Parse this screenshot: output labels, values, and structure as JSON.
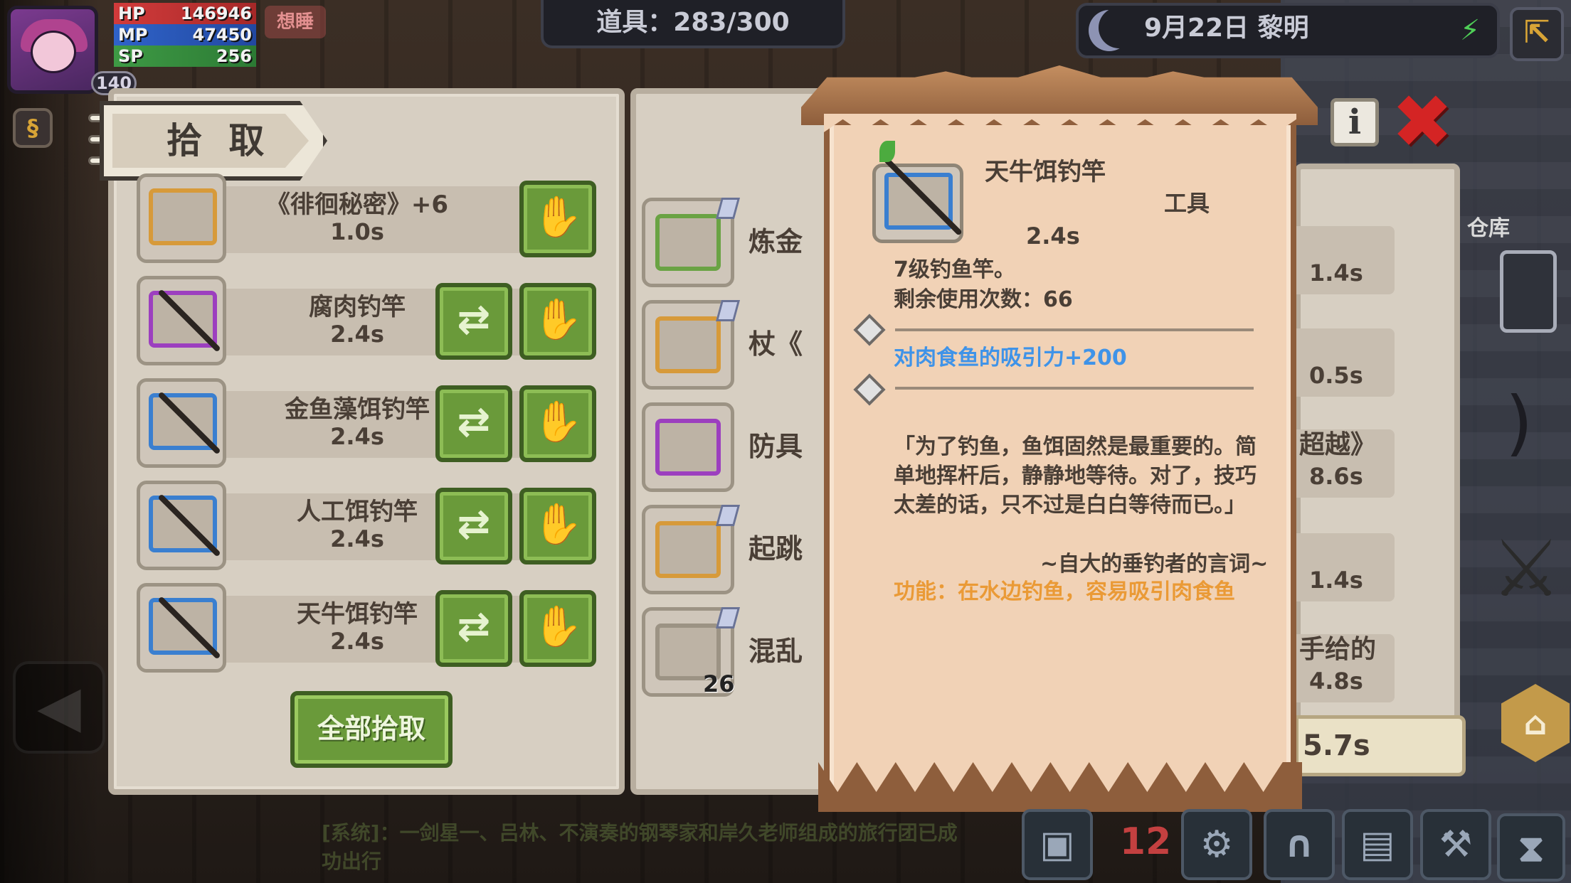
{
  "hud": {
    "hp_label": "HP",
    "hp_value": "146946",
    "mp_label": "MP",
    "mp_value": "47450",
    "sp_label": "SP",
    "sp_value": "256",
    "level": "140",
    "status": "想睡",
    "inventory_counter": "道具：283/300",
    "date": "9月22日  黎明"
  },
  "pickup": {
    "title": "拾 取",
    "items": [
      {
        "name": "《徘徊秘密》+6",
        "time": "1.0s",
        "frame_color": "#d79a3a"
      },
      {
        "name": "腐肉钓竿",
        "time": "2.4s",
        "frame_color": "#9c3fbf"
      },
      {
        "name": "金鱼藻饵钓竿",
        "time": "2.4s",
        "frame_color": "#3a7fd0"
      },
      {
        "name": "人工饵钓竿",
        "time": "2.4s",
        "frame_color": "#3a7fd0"
      },
      {
        "name": "天牛饵钓竿",
        "time": "2.4s",
        "frame_color": "#3a7fd0"
      }
    ],
    "swap_glyph": "⇄",
    "pick_glyph": "✋",
    "pickup_all": "全部拾取"
  },
  "middle": {
    "items": [
      {
        "label": "炼金",
        "count": ""
      },
      {
        "label": "杖《",
        "count": ""
      },
      {
        "label": "防具",
        "count": ""
      },
      {
        "label": "起跳",
        "count": ""
      },
      {
        "label": "混乱",
        "count": "26"
      }
    ]
  },
  "storage": {
    "label": "仓库",
    "rows": [
      {
        "name": "",
        "time": "1.4s"
      },
      {
        "name": "",
        "time": "0.5s"
      },
      {
        "name": "超越》",
        "time": "8.6s"
      },
      {
        "name": "",
        "time": "1.4s"
      },
      {
        "name": "手给的",
        "time": "4.8s"
      }
    ],
    "total": "5.7s"
  },
  "detail": {
    "name": "天牛饵钓竿",
    "type": "工具",
    "time": "2.4s",
    "desc_level": "7级钓鱼竿。",
    "desc_uses": "剩余使用次数：66",
    "effect": "对肉食鱼的吸引力+200",
    "quote": "「为了钓鱼，鱼饵固然是最重要的。简单地挥杆后，静静地等待。对了，技巧太差的话，只不过是白白等待而已。」",
    "quote_source": "~自大的垂钓者的言词~",
    "function": "功能：在水边钓鱼，容易吸引肉食鱼",
    "info_glyph": "i",
    "close_glyph": "✖"
  },
  "chat": {
    "message": "[系统]：一剑星一、吕林、不演奏的钢琴家和岸久老师组成的旅行团已成功出行"
  },
  "icons": {
    "moon": "moon-icon",
    "wifi": "wifi-icon",
    "exit": "exit-icon"
  },
  "colors": {
    "accent_green": "#6a9a3a",
    "effect_blue": "#3f93e8",
    "function_orange": "#ea9a36",
    "close_red": "#d42424"
  }
}
